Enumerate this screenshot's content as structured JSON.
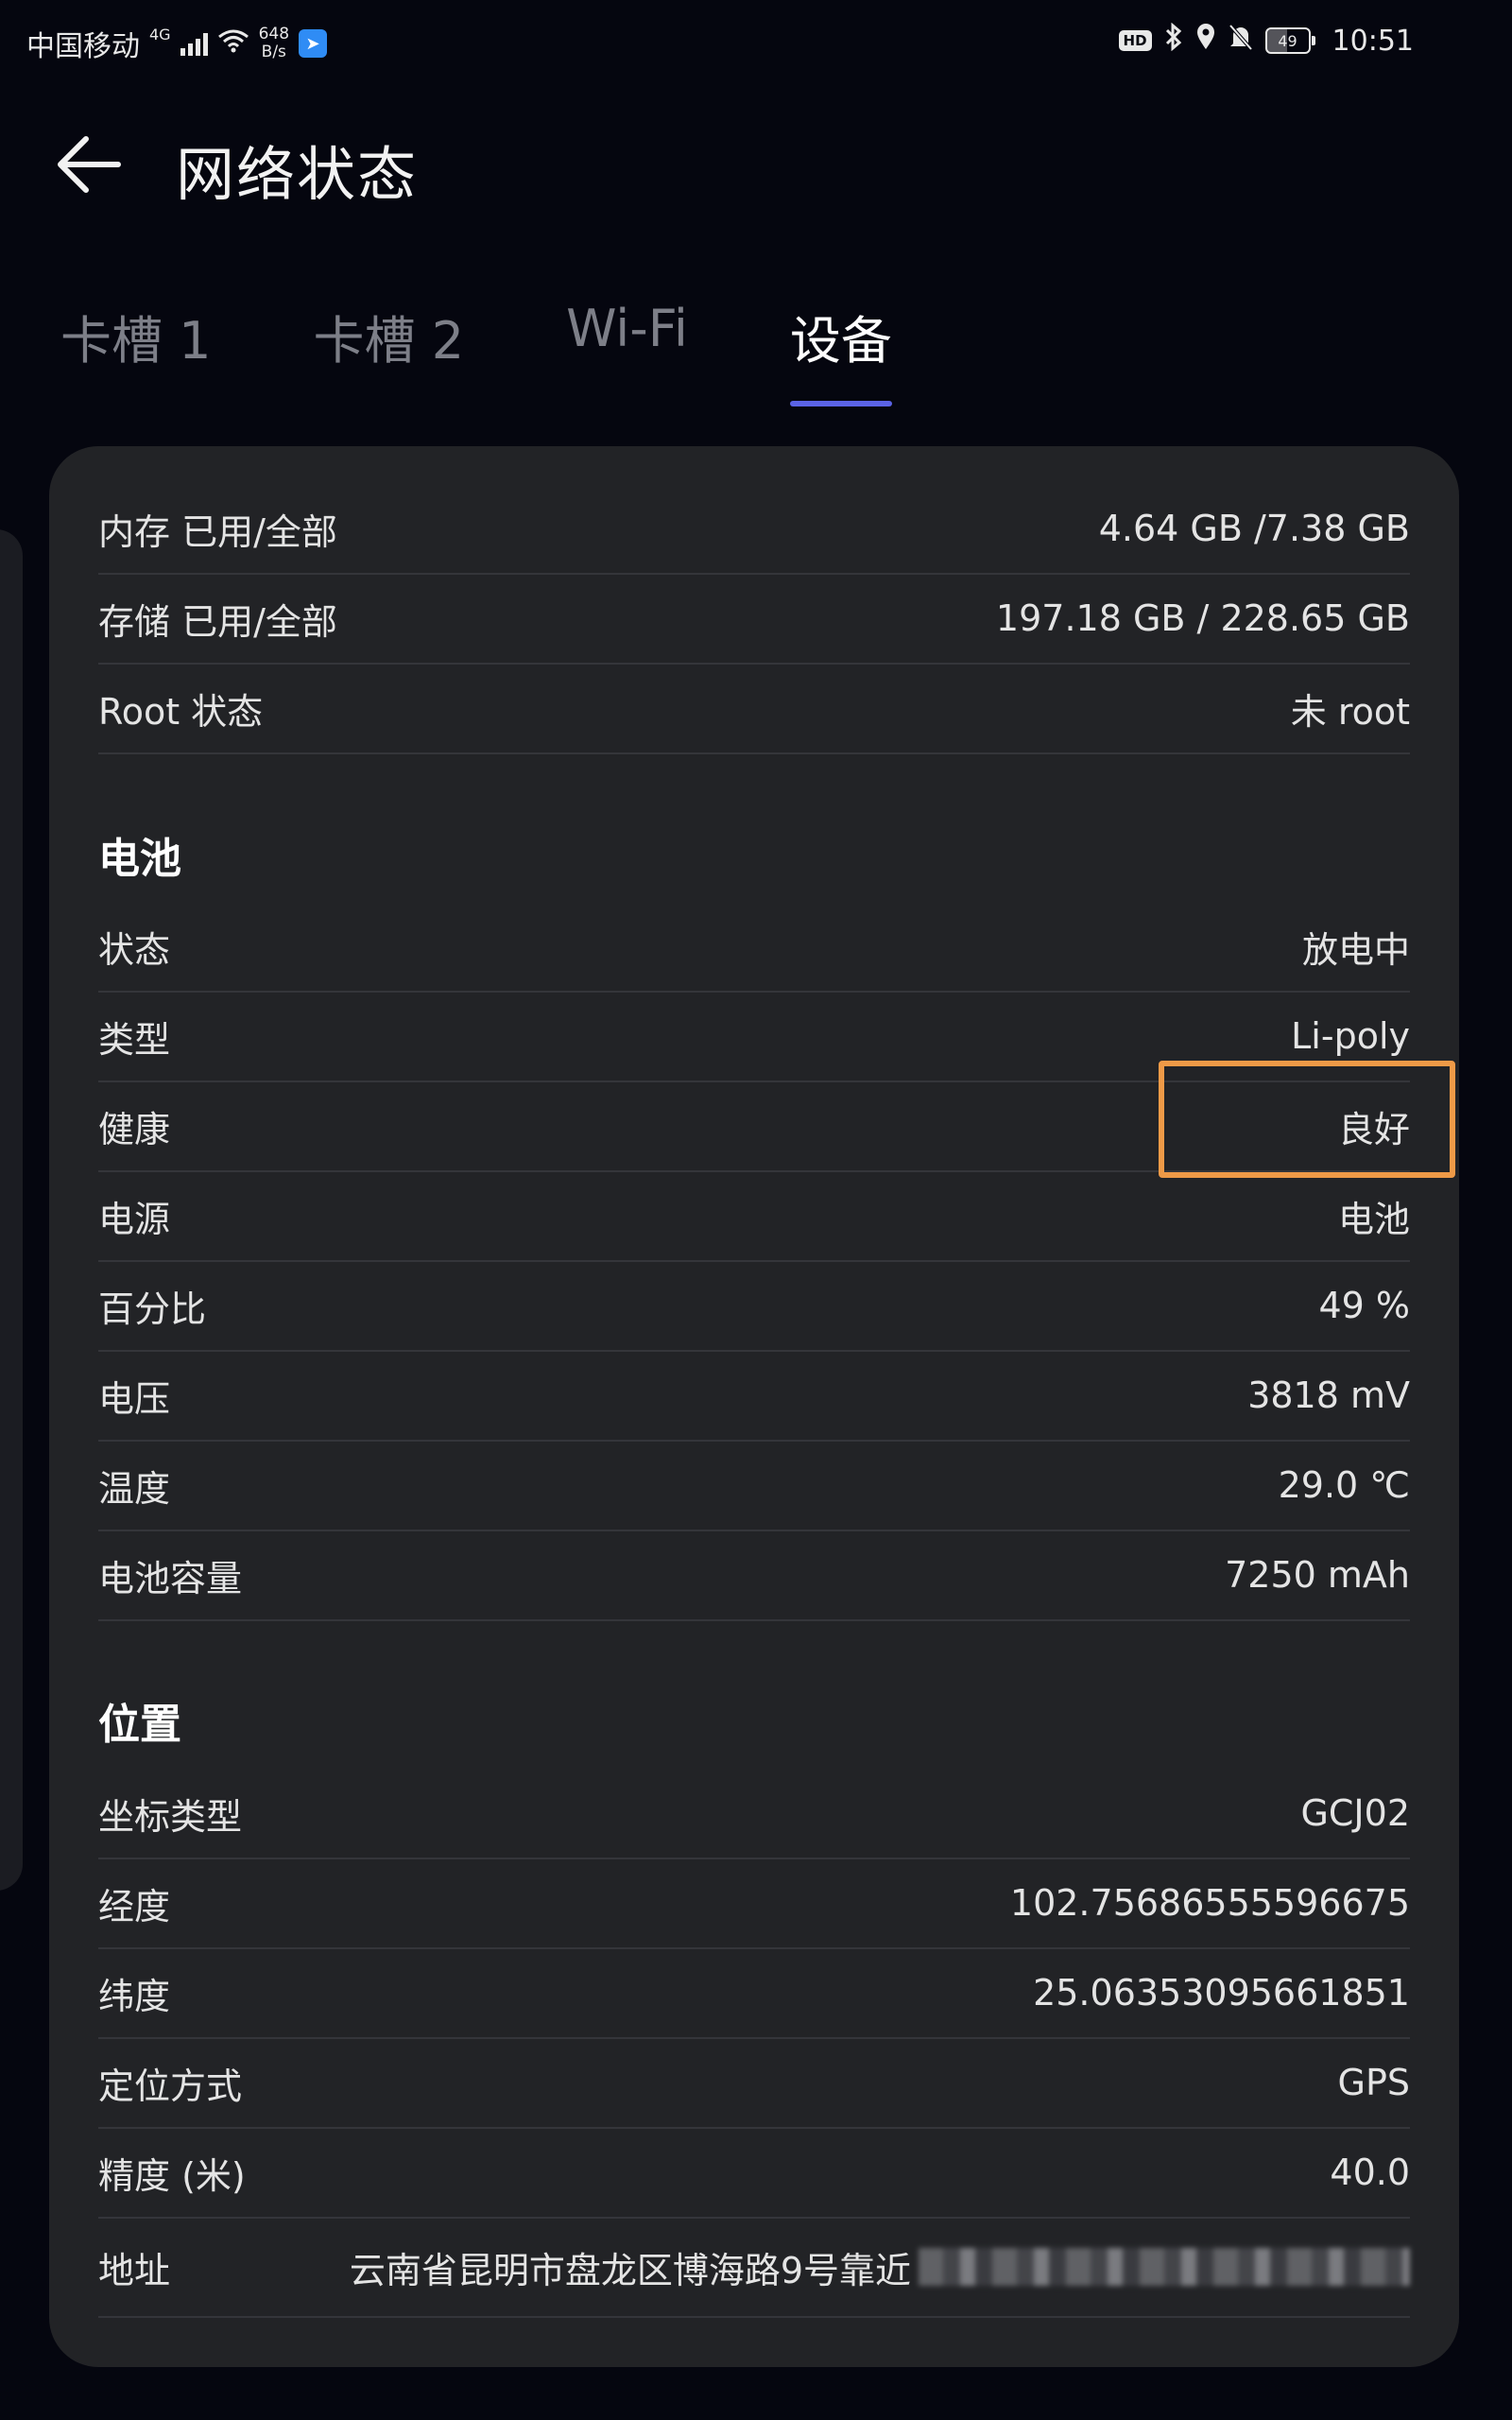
{
  "status_bar": {
    "carrier": "中国移动",
    "network": "4G",
    "speed_value": "648",
    "speed_unit": "B/s",
    "hd_label": "HD",
    "battery_percent": "49",
    "time": "10:51",
    "icons": [
      "signal-icon",
      "wifi-icon",
      "app-icon",
      "bluetooth-icon",
      "location-icon",
      "mute-bell-icon",
      "battery-icon"
    ]
  },
  "header": {
    "back_icon": "back-arrow-icon",
    "title": "网络状态"
  },
  "tabs": [
    {
      "label": "卡槽 1",
      "active": false
    },
    {
      "label": "卡槽 2",
      "active": false
    },
    {
      "label": "Wi-Fi",
      "active": false
    },
    {
      "label": "设备",
      "active": true
    }
  ],
  "colors": {
    "accent": "#5b63e6",
    "highlight": "#ef9a47",
    "background": "#05060f",
    "card": "#222326"
  },
  "device": {
    "memory": {
      "label": "内存 已用/全部",
      "value": "4.64 GB /7.38 GB"
    },
    "storage": {
      "label": "存储 已用/全部",
      "value": "197.18 GB / 228.65 GB"
    },
    "root": {
      "label": "Root 状态",
      "value": "未 root"
    }
  },
  "battery": {
    "title": "电池",
    "rows": [
      {
        "label": "状态",
        "value": "放电中"
      },
      {
        "label": "类型",
        "value": "Li-poly"
      },
      {
        "label": "健康",
        "value": "良好"
      },
      {
        "label": "电源",
        "value": "电池"
      },
      {
        "label": "百分比",
        "value": "49 %"
      },
      {
        "label": "电压",
        "value": "3818 mV"
      },
      {
        "label": "温度",
        "value": "29.0 ℃"
      },
      {
        "label": "电池容量",
        "value": "7250 mAh"
      }
    ]
  },
  "location": {
    "title": "位置",
    "rows": [
      {
        "label": "坐标类型",
        "value": "GCJ02"
      },
      {
        "label": "经度",
        "value": "102.75686555596675"
      },
      {
        "label": "纬度",
        "value": "25.06353095661851"
      },
      {
        "label": "定位方式",
        "value": "GPS"
      },
      {
        "label": "精度 (米)",
        "value": "40.0"
      }
    ],
    "address": {
      "label": "地址",
      "value_visible": "云南省昆明市盘龙区博海路9号靠近"
    }
  }
}
